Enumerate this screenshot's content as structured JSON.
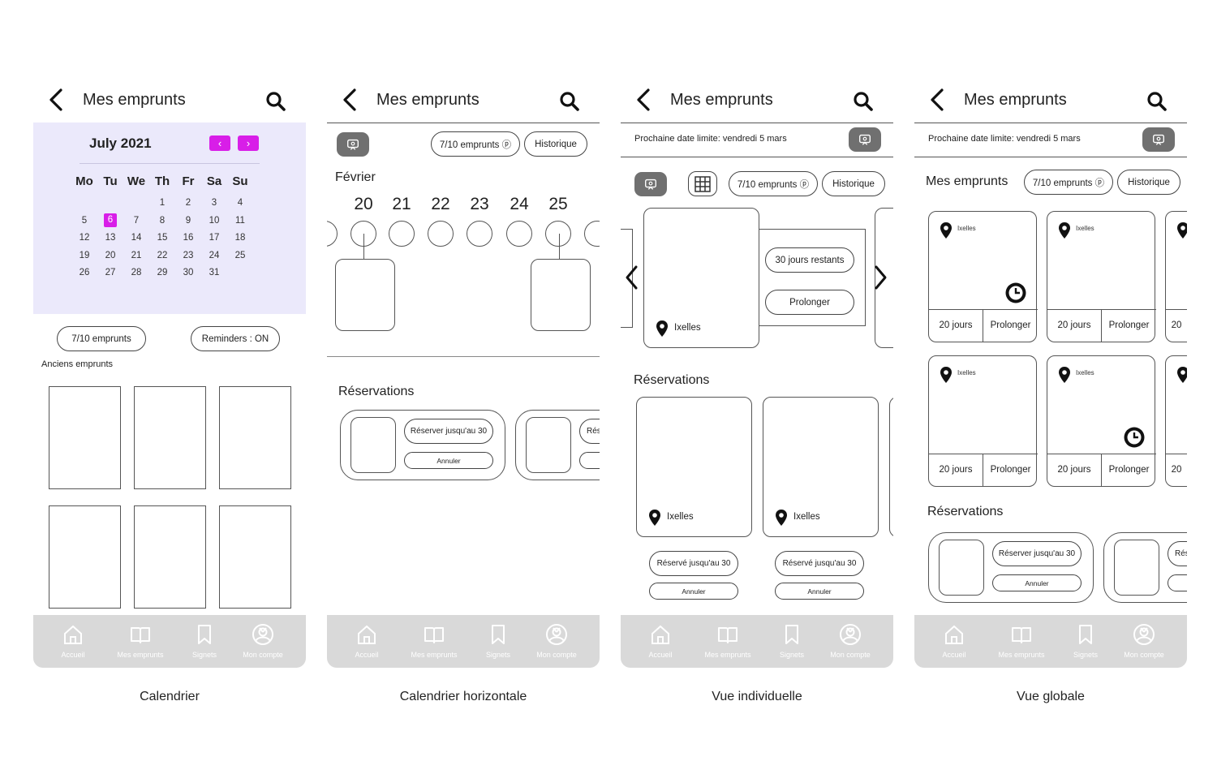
{
  "screens": [
    {
      "header": {
        "title": "Mes emprunts"
      },
      "calendar": {
        "month": "July 2021",
        "weekdays": [
          "Mo",
          "Tu",
          "We",
          "Th",
          "Fr",
          "Sa",
          "Su"
        ],
        "weeks": [
          [
            "",
            "",
            "",
            "1",
            "2",
            "3",
            "4"
          ],
          [
            "5",
            "6",
            "7",
            "8",
            "9",
            "10",
            "11"
          ],
          [
            "12",
            "13",
            "14",
            "15",
            "16",
            "17",
            "18"
          ],
          [
            "19",
            "20",
            "21",
            "22",
            "23",
            "24",
            "25"
          ],
          [
            "26",
            "27",
            "28",
            "29",
            "30",
            "31",
            ""
          ]
        ],
        "selected_day": "6",
        "accent": "#d81ee8"
      },
      "emprunts_btn": "7/10 emprunts",
      "reminders_btn": "Reminders : ON",
      "anciens_label": "Anciens emprunts"
    },
    {
      "header": {
        "title": "Mes emprunts"
      },
      "emprunts_btn": "7/10 emprunts ⓟ",
      "historique_btn": "Historique",
      "month": "Février",
      "days": [
        "20",
        "21",
        "22",
        "23",
        "24",
        "25"
      ],
      "reservations_title": "Réservations",
      "reserve_btn": "Réserver jusqu'au 30",
      "reserve_btn_cut": "Rés",
      "annuler_btn": "Annuler"
    },
    {
      "header": {
        "title": "Mes emprunts"
      },
      "deadline": "Prochaine date limite: vendredi 5 mars",
      "emprunts_btn": "7/10 emprunts ⓟ",
      "historique_btn": "Historique",
      "jours_restants": "30 jours restants",
      "prolonger": "Prolonger",
      "location": "Ixelles",
      "reservations_title": "Réservations",
      "reserve_label": "Réservé jusqu'au 30",
      "annuler_btn": "Annuler"
    },
    {
      "header": {
        "title": "Mes emprunts"
      },
      "deadline": "Prochaine date limite: vendredi 5 mars",
      "section_title": "Mes emprunts",
      "emprunts_btn": "7/10 emprunts ⓟ",
      "historique_btn": "Historique",
      "location": "Ixelles",
      "jours": "20 jours",
      "jours_cut": "20",
      "prolonger": "Prolonger",
      "reservations_title": "Réservations",
      "reserve_btn": "Réserver jusqu'au 30",
      "reserve_btn_cut": "Rés",
      "annuler_btn": "Annuler"
    }
  ],
  "nav": {
    "accueil": "Accueil",
    "mes_emprunts": "Mes emprunts",
    "signets": "Signets",
    "mon_compte": "Mon compte"
  },
  "captions": [
    "Calendrier",
    "Calendrier horizontale",
    "Vue individuelle",
    "Vue globale"
  ]
}
